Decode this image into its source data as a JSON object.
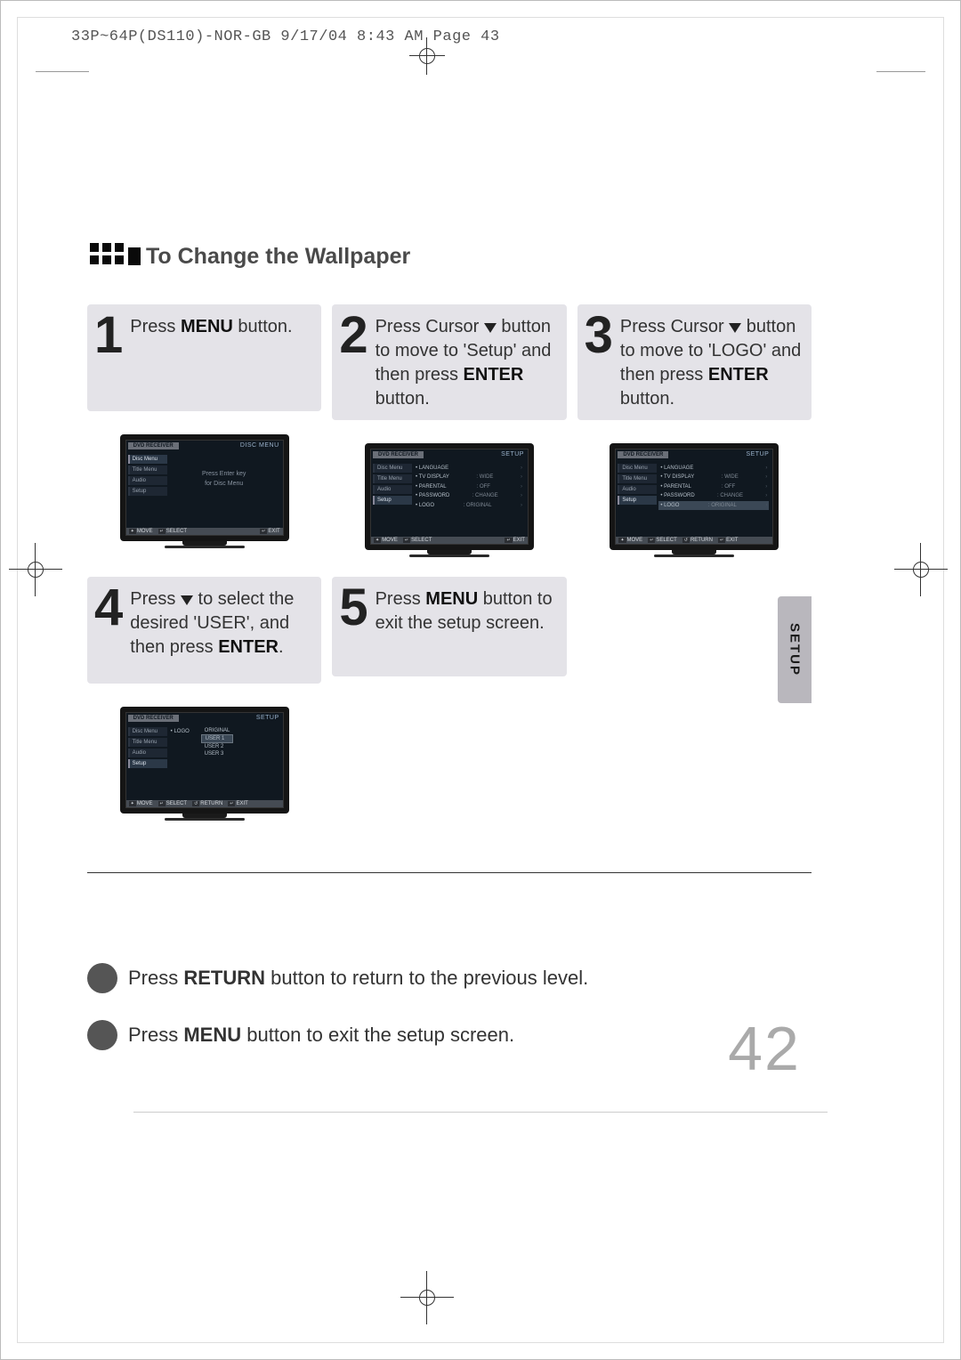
{
  "header": {
    "crop_info": "33P~64P(DS110)-NOR-GB  9/17/04 8:43 AM  Page 43"
  },
  "title": "To Change the Wallpaper",
  "steps": {
    "s1": {
      "num": "1",
      "pre": "Press ",
      "bold": "MENU",
      "post": " button."
    },
    "s2": {
      "num": "2",
      "pre": "Press Cursor ",
      "mid": " button to move to 'Setup' and then press ",
      "bold": "ENTER",
      "post": " button."
    },
    "s3": {
      "num": "3",
      "pre": "Press Cursor ",
      "mid": " button to move to 'LOGO' and then press ",
      "bold": "ENTER",
      "post": " button."
    },
    "s4": {
      "num": "4",
      "pre": "Press ",
      "mid": " to select the desired 'USER', and then press ",
      "bold": "ENTER",
      "post": "."
    },
    "s5": {
      "num": "5",
      "pre": "Press ",
      "bold": "MENU",
      "post": " button to exit the setup screen."
    }
  },
  "tv": {
    "tab": "DVD RECEIVER",
    "disc_menu_title": "DISC MENU",
    "setup_title": "SETUP",
    "sidebar": {
      "disc_menu": "Disc Menu",
      "title_menu": "Title Menu",
      "audio": "Audio",
      "setup": "Setup"
    },
    "center1": "Press Enter key",
    "center2": "for Disc Menu",
    "setup_rows": {
      "language": {
        "label": "LANGUAGE",
        "val": ""
      },
      "tv_display": {
        "label": "TV DISPLAY",
        "val": "WIDE"
      },
      "parental": {
        "label": "PARENTAL",
        "val": "OFF"
      },
      "password": {
        "label": "PASSWORD",
        "val": "CHANGE"
      },
      "logo": {
        "label": "LOGO",
        "val": "ORIGINAL"
      }
    },
    "logo_options": {
      "label": "LOGO",
      "original": "ORIGINAL",
      "user1": "USER 1",
      "user2": "USER 2",
      "user3": "USER 3"
    },
    "footer": {
      "move": "MOVE",
      "select": "SELECT",
      "ret": "RETURN",
      "exit": "EXIT"
    }
  },
  "notes": {
    "n1_pre": "Press ",
    "n1_bold": "RETURN",
    "n1_post": " button to return to the previous level.",
    "n2_pre": "Press ",
    "n2_bold": "MENU",
    "n2_post": " button to exit the setup screen."
  },
  "side_tab": "SETUP",
  "page_number": "42"
}
